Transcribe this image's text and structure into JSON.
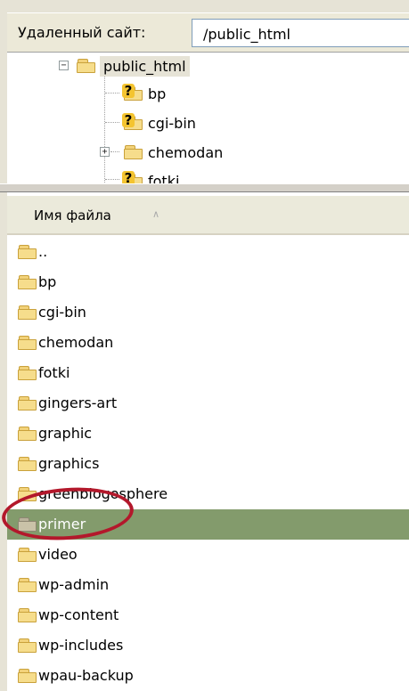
{
  "path_bar": {
    "label": "Удаленный сайт:",
    "path": "/public_html"
  },
  "tree": {
    "root": "public_html",
    "children": [
      {
        "name": "bp",
        "icon": "unknown-folder-icon"
      },
      {
        "name": "cgi-bin",
        "icon": "unknown-folder-icon"
      },
      {
        "name": "chemodan",
        "icon": "folder-icon",
        "expandable": true
      },
      {
        "name": "fotki",
        "icon": "unknown-folder-icon"
      }
    ]
  },
  "file_list": {
    "column_header": "Имя файла",
    "sort_indicator": "∧",
    "rows": [
      "..",
      "bp",
      "cgi-bin",
      "chemodan",
      "fotki",
      "gingers-art",
      "graphic",
      "graphics",
      "greenblogosphere",
      "primer",
      "video",
      "wp-admin",
      "wp-content",
      "wp-includes",
      "wpau-backup"
    ],
    "selected_row": "primer"
  },
  "colors": {
    "selection": "#839b6c",
    "annotation_circle": "#b3182b"
  }
}
